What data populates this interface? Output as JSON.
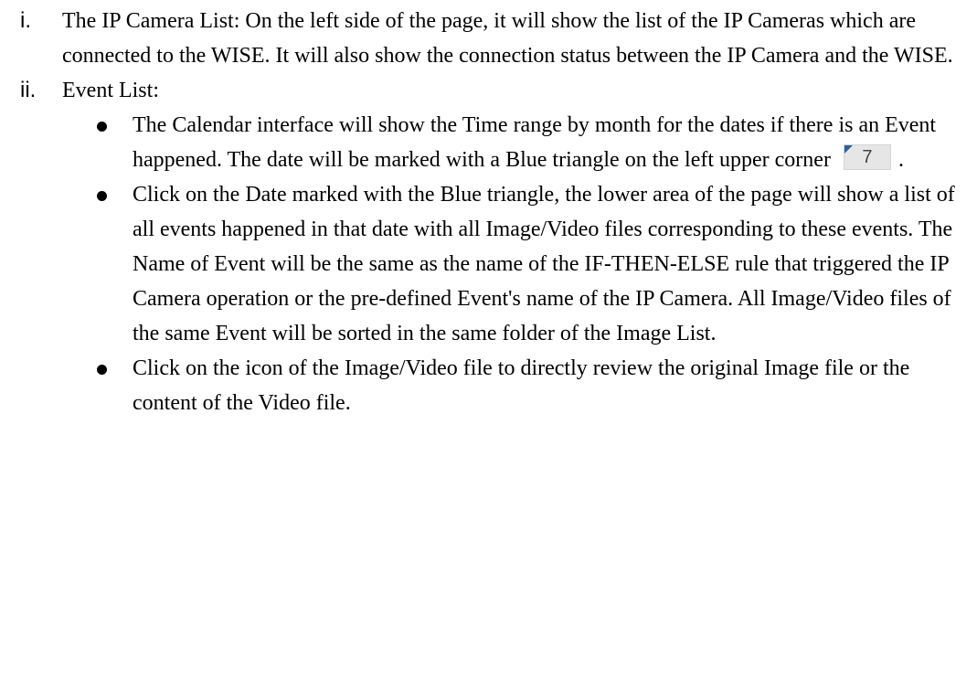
{
  "items": [
    {
      "marker": "i.",
      "text": "The IP Camera List: On the left side of the page, it will show the list of the IP Cameras which are connected to the WISE. It will also show the connection status between the IP Camera and the WISE."
    },
    {
      "marker": "ii.",
      "text": "Event List:",
      "bullets": [
        {
          "text": "The Calendar interface will show the Time range by month for the dates if there is an Event happened. The date will be marked with a Blue triangle on the left upper corner",
          "inline_image": {
            "date_number": "7",
            "triangle_color": "#2f5f9f",
            "background_color": "#e6e6e6"
          },
          "text_after": "."
        },
        {
          "text": "Click on the Date marked with the Blue triangle, the lower area of the page will show a list of all events happened in that date with all Image/Video files corresponding to these events. The Name of Event will be the same as the name of the IF-THEN-ELSE rule that triggered the IP Camera operation or the pre-defined Event's name of the IP Camera. All Image/Video files of the same Event will be sorted in the same folder of the Image List."
        },
        {
          "text": "Click on the icon of the Image/Video file to directly review the original Image file or the content of the Video file."
        }
      ]
    }
  ]
}
